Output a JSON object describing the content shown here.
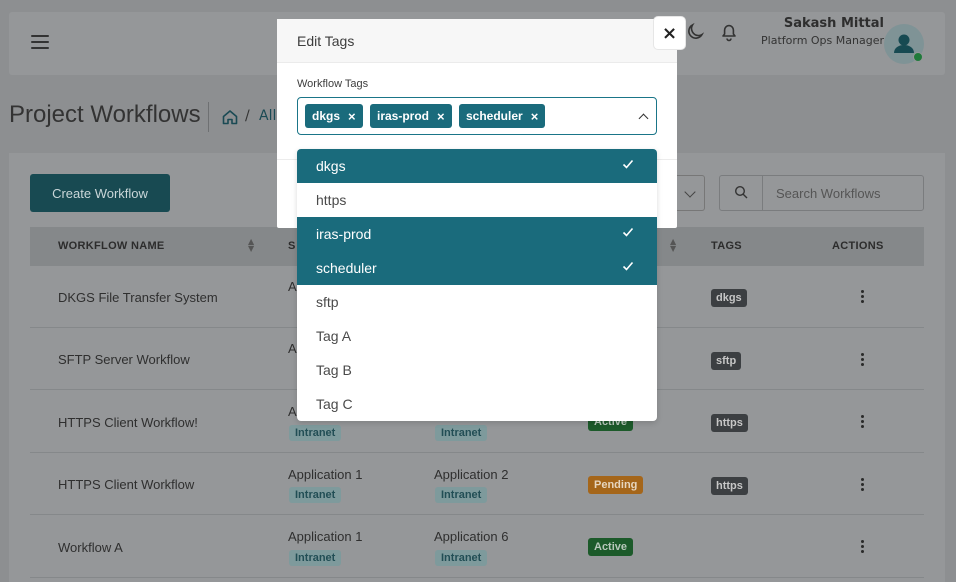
{
  "header": {
    "user_name": "Sakash Mittal",
    "user_role": "Platform Ops Manager"
  },
  "page": {
    "title": "Project Workflows",
    "breadcrumb_separator": "/",
    "breadcrumb_all": "All"
  },
  "toolbar": {
    "create_label": "Create Workflow",
    "search_placeholder": "Search Workflows"
  },
  "table": {
    "headers": {
      "workflow_name": "WORKFLOW NAME",
      "source": "S",
      "tags": "TAGS",
      "actions": "ACTIONS"
    },
    "rows": [
      {
        "name": "DKGS File Transfer System",
        "source": "A",
        "source_env": "",
        "dest": "",
        "dest_env": "",
        "status": "",
        "tag": "dkgs"
      },
      {
        "name": "SFTP Server Workflow",
        "source": "A",
        "source_env": "",
        "dest": "",
        "dest_env": "",
        "status": "",
        "tag": "sftp"
      },
      {
        "name": "HTTPS Client Workflow!",
        "source": "A",
        "source_env": "Intranet",
        "dest": "",
        "dest_env": "Intranet",
        "status": "Active",
        "tag": "https"
      },
      {
        "name": "HTTPS Client Workflow",
        "source": "Application 1",
        "source_env": "Intranet",
        "dest": "Application 2",
        "dest_env": "Intranet",
        "status": "Pending",
        "tag": "https"
      },
      {
        "name": "Workflow A",
        "source": "Application 1",
        "source_env": "Intranet",
        "dest": "Application 6",
        "dest_env": "Intranet",
        "status": "Active",
        "tag": ""
      }
    ]
  },
  "modal": {
    "title": "Edit Tags",
    "close_symbol": "×",
    "field_label": "Workflow Tags",
    "selected_tags": [
      "dkgs",
      "iras-prod",
      "scheduler"
    ],
    "remove_symbol": "×",
    "options": [
      {
        "label": "dkgs",
        "selected": true
      },
      {
        "label": "https",
        "selected": false
      },
      {
        "label": "iras-prod",
        "selected": true
      },
      {
        "label": "scheduler",
        "selected": true
      },
      {
        "label": "sftp",
        "selected": false
      },
      {
        "label": "Tag A",
        "selected": false
      },
      {
        "label": "Tag B",
        "selected": false
      },
      {
        "label": "Tag C",
        "selected": false
      }
    ]
  },
  "colors": {
    "accent": "#1a6b7c",
    "active_status": "#1c5a2a",
    "pending_status": "#a5661a"
  },
  "icons": [
    "menu-icon",
    "moon-icon",
    "bell-icon",
    "user-avatar-icon",
    "home-icon",
    "search-icon",
    "sort-icon",
    "kebab-icon",
    "close-icon",
    "chevron-up-icon",
    "check-icon"
  ]
}
